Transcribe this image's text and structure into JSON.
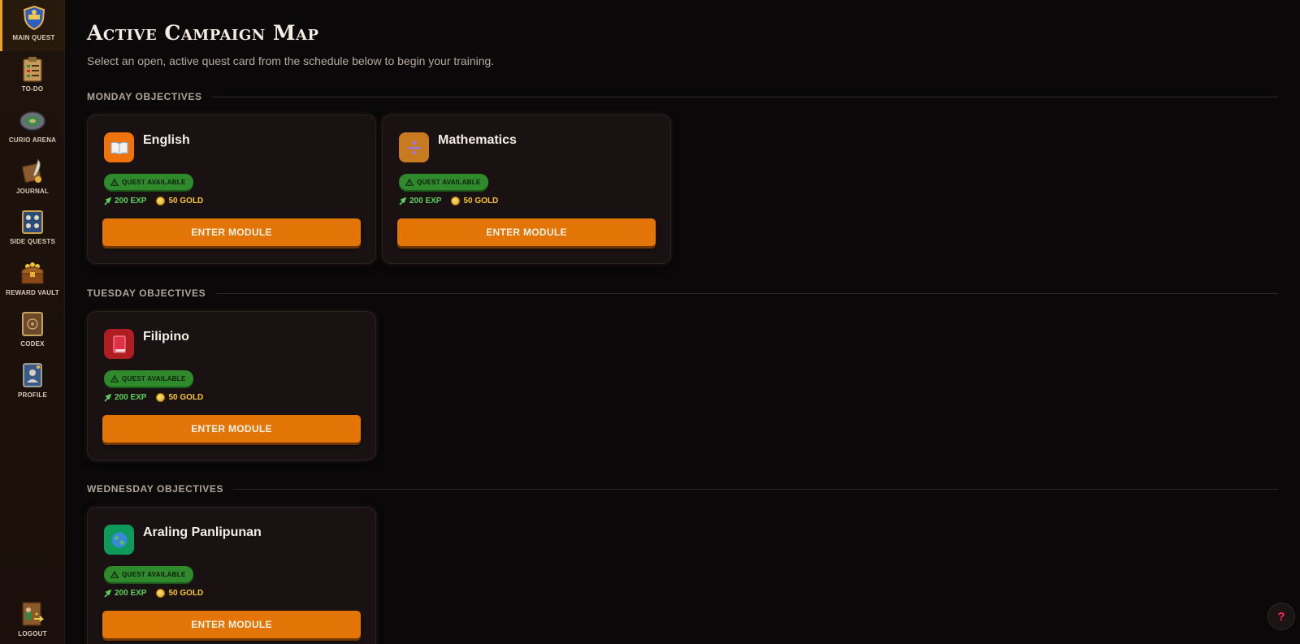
{
  "sidebar": {
    "items": [
      {
        "label": "MAIN QUEST",
        "icon": "shield-crest-icon",
        "active": true
      },
      {
        "label": "TO-DO",
        "icon": "clipboard-icon",
        "active": false
      },
      {
        "label": "CURIO ARENA",
        "icon": "arena-icon",
        "active": false
      },
      {
        "label": "JOURNAL",
        "icon": "quill-scroll-icon",
        "active": false
      },
      {
        "label": "SIDE QUESTS",
        "icon": "quest-board-icon",
        "active": false
      },
      {
        "label": "REWARD VAULT",
        "icon": "treasure-chest-icon",
        "active": false
      },
      {
        "label": "CODEX",
        "icon": "book-codex-icon",
        "active": false
      },
      {
        "label": "PROFILE",
        "icon": "id-card-icon",
        "active": false
      }
    ],
    "logout": {
      "label": "LOGOUT",
      "icon": "door-exit-icon"
    }
  },
  "header": {
    "title": "Active Campaign Map",
    "subtitle": "Select an open, active quest card from the schedule below to begin your training."
  },
  "sections": [
    {
      "title": "MONDAY OBJECTIVES",
      "cards": [
        {
          "title": "English",
          "icon": "open-book-icon",
          "icon_bg": "#f0720a",
          "badge": "QUEST AVAILABLE",
          "exp": "200 EXP",
          "gold": "50 GOLD",
          "button": "ENTER MODULE"
        },
        {
          "title": "Mathematics",
          "icon": "divide-icon",
          "icon_bg": "#c87a20",
          "badge": "QUEST AVAILABLE",
          "exp": "200 EXP",
          "gold": "50 GOLD",
          "button": "ENTER MODULE"
        }
      ]
    },
    {
      "title": "TUESDAY OBJECTIVES",
      "cards": [
        {
          "title": "Filipino",
          "icon": "red-book-icon",
          "icon_bg": "#b01e22",
          "badge": "QUEST AVAILABLE",
          "exp": "200 EXP",
          "gold": "50 GOLD",
          "button": "ENTER MODULE"
        }
      ]
    },
    {
      "title": "WEDNESDAY OBJECTIVES",
      "cards": [
        {
          "title": "Araling Panlipunan",
          "icon": "globe-icon",
          "icon_bg": "#0f9a5a",
          "badge": "QUEST AVAILABLE",
          "exp": "200 EXP",
          "gold": "50 GOLD",
          "button": "ENTER MODULE"
        }
      ]
    }
  ],
  "help": {
    "label": "?"
  },
  "colors": {
    "accent": "#e37406",
    "badge_green": "#2e8a2a",
    "exp_green": "#5cd05a",
    "gold": "#f4c430",
    "background": "#0a0808",
    "sidebar": "#1e120c"
  }
}
